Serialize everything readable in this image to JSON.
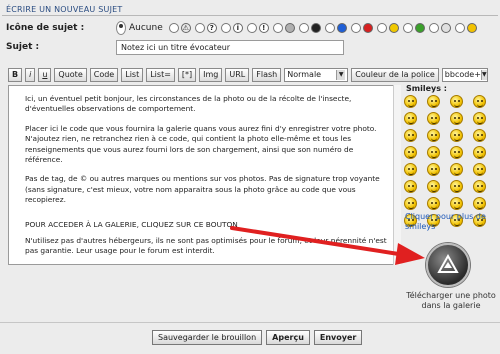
{
  "header": {
    "title": "ÉCRIRE UN NOUVEAU SUJET"
  },
  "topic_icon": {
    "label": "Icône de sujet :",
    "selected_label": "Aucune",
    "options": [
      {
        "icon": "warning-icon",
        "color": "#e8e8e8",
        "glyph": "⚠"
      },
      {
        "icon": "help-icon",
        "color": "#ffffff",
        "glyph": "?"
      },
      {
        "icon": "info-icon",
        "color": "#ffffff",
        "glyph": "i"
      },
      {
        "icon": "exclamation-icon",
        "color": "#ffffff",
        "glyph": "!"
      },
      {
        "icon": "grey-dot-icon",
        "color": "#b0b0b0",
        "glyph": ""
      },
      {
        "icon": "black-dot-icon",
        "color": "#222222",
        "glyph": ""
      },
      {
        "icon": "blue-dot-icon",
        "color": "#1f5fd6",
        "glyph": ""
      },
      {
        "icon": "red-dot-icon",
        "color": "#d62020",
        "glyph": ""
      },
      {
        "icon": "yellow-dot-icon",
        "color": "#f0c800",
        "glyph": ""
      },
      {
        "icon": "green-dot-icon",
        "color": "#3aa02a",
        "glyph": ""
      },
      {
        "icon": "light-dot-icon",
        "color": "#e0e0e0",
        "glyph": ""
      },
      {
        "icon": "sad-face-icon",
        "color": "#f2c200",
        "glyph": ""
      }
    ]
  },
  "subject": {
    "label": "Sujet :",
    "value": "Notez ici un titre évocateur"
  },
  "toolbar": {
    "buttons": [
      "B",
      "i",
      "u",
      "Quote",
      "Code",
      "List",
      "List=",
      "[*]",
      "Img",
      "URL",
      "Flash"
    ],
    "size_select": "Normale",
    "color_button": "Couleur de la police",
    "bbcode_select": "bbcode+"
  },
  "editor": {
    "p1": "Ici, un éventuel petit bonjour, les circonstances de la photo ou de la récolte de l'insecte, d'éventuelles observations de comportement.",
    "p2": "Placer ici le code que vous fournira la galerie quans vous aurez fini d'y enregistrer votre photo. N'ajoutez rien, ne retranchez rien à ce code, qui contient la photo elle-même et tous les renseignements que vous aurez fourni lors de son chargement, ainsi que son numéro de référence.",
    "p3": "Pas de tag, de © ou autres marques ou mentions sur vos photos. Pas de signature trop voyante (sans signature, c'est mieux, votre nom apparaitra sous la photo grâce au code que vous recopierez.",
    "cta": "POUR ACCEDER À LA GALERIE, CLIQUEZ SUR CE BOUTON",
    "p4": "N'utilisez pas d'autres hébergeurs, ils ne sont pas optimisés pour le forum, et leur pérennité n'est pas garantie. Leur usage pour le forum est interdit."
  },
  "smileys": {
    "title": "Smileys :",
    "count": 32,
    "more_link": "Cliquer pour plus de smileys"
  },
  "upload": {
    "label": "Télécharger une photo dans la galerie"
  },
  "footer": {
    "save_draft": "Sauvegarder le brouillon",
    "preview": "Aperçu",
    "send": "Envoyer"
  },
  "colors": {
    "accent": "#2b4d82",
    "arrow": "#e02020",
    "link": "#1d57b7"
  }
}
